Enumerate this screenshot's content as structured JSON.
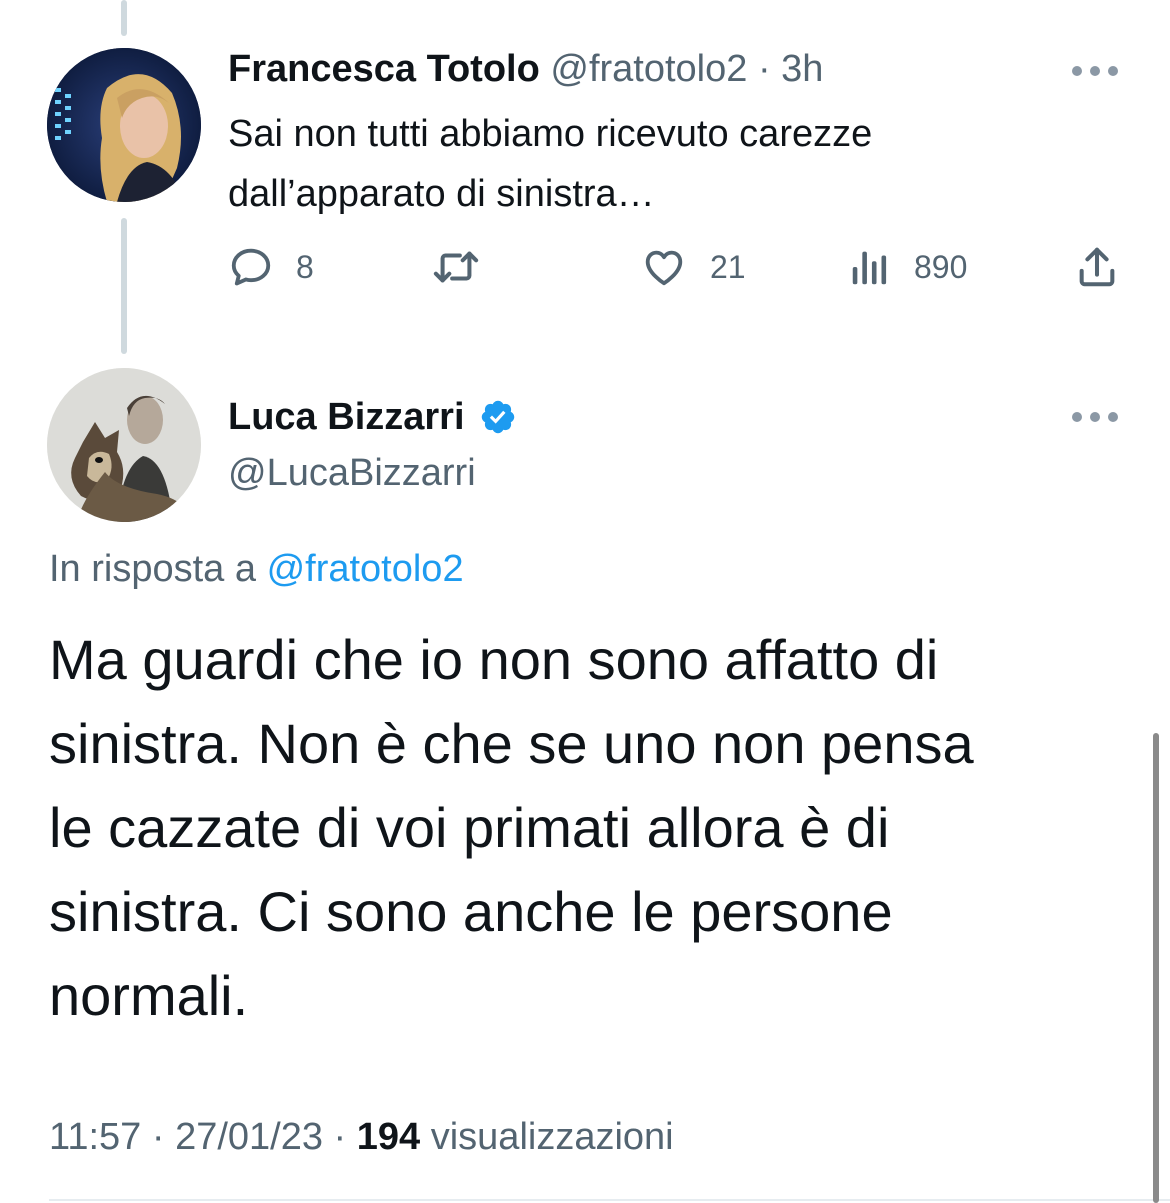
{
  "parent_tweet": {
    "author_name": "Francesca Totolo",
    "author_handle": "@fratotolo2",
    "separator": "·",
    "time": "3h",
    "text": "Sai non tutti abbiamo ricevuto carezze\ndall’apparato di sinistra…",
    "actions": {
      "replies": "8",
      "retweets": "",
      "likes": "21",
      "views": "890"
    }
  },
  "main_tweet": {
    "author_name": "Luca Bizzarri",
    "author_handle": "@LucaBizzarri",
    "reply_prefix": "In risposta a",
    "reply_to": "@fratotolo2",
    "text": "Ma guardi che io non sono affatto di\nsinistra. Non è che se uno non pensa\nle cazzate di voi primati allora è di\nsinistra. Ci sono anche le persone\nnormali.",
    "time": "11:57",
    "date": "27/01/23",
    "views_count": "194",
    "views_label": "visualizzazioni",
    "separator": "·"
  },
  "colors": {
    "text": "#0f1419",
    "muted": "#536471",
    "link": "#1d9bf0",
    "thread_line": "#cfd9de"
  },
  "icons": [
    "reply-icon",
    "retweet-icon",
    "like-icon",
    "views-icon",
    "share-icon",
    "more-icon",
    "verified-badge-icon"
  ]
}
